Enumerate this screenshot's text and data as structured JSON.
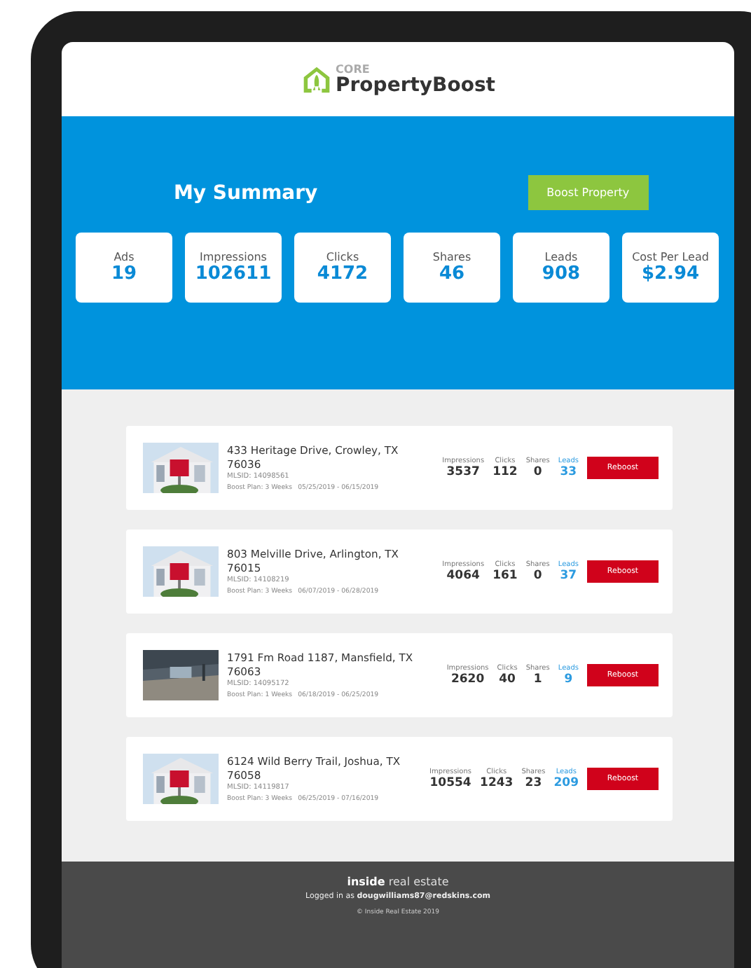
{
  "logo": {
    "small": "CORE",
    "name": "PropertyBoost"
  },
  "summary": {
    "title": "My Summary",
    "button": "Boost Property",
    "stats": [
      {
        "label": "Ads",
        "value": "19"
      },
      {
        "label": "Impressions",
        "value": "102611"
      },
      {
        "label": "Clicks",
        "value": "4172"
      },
      {
        "label": "Shares",
        "value": "46"
      },
      {
        "label": "Leads",
        "value": "908"
      },
      {
        "label": "Cost Per Lead",
        "value": "$2.94"
      }
    ]
  },
  "listings": [
    {
      "address": "433 Heritage Drive, Crowley, TX 76036",
      "mlsid": "MLSID: 14098561",
      "plan": "Boost Plan: 3 Weeks",
      "dates": "05/25/2019 - 06/15/2019",
      "button": "Reboost",
      "stats": [
        {
          "label": "Impressions",
          "value": "3537",
          "kind": "plain"
        },
        {
          "label": "Clicks",
          "value": "112",
          "kind": "plain"
        },
        {
          "label": "Shares",
          "value": "0",
          "kind": "plain"
        },
        {
          "label": "Leads",
          "value": "33",
          "kind": "lead"
        }
      ]
    },
    {
      "address": "803 Melville Drive, Arlington, TX 76015",
      "mlsid": "MLSID: 14108219",
      "plan": "Boost Plan: 3 Weeks",
      "dates": "06/07/2019 - 06/28/2019",
      "button": "Reboost",
      "stats": [
        {
          "label": "Impressions",
          "value": "4064",
          "kind": "plain"
        },
        {
          "label": "Clicks",
          "value": "161",
          "kind": "plain"
        },
        {
          "label": "Shares",
          "value": "0",
          "kind": "plain"
        },
        {
          "label": "Leads",
          "value": "37",
          "kind": "lead"
        }
      ]
    },
    {
      "address": "1791 Fm Road 1187, Mansfield, TX 76063",
      "mlsid": "MLSID: 14095172",
      "plan": "Boost Plan: 1 Weeks",
      "dates": "06/18/2019 - 06/25/2019",
      "button": "Reboost",
      "stats": [
        {
          "label": "Impressions",
          "value": "2620",
          "kind": "plain"
        },
        {
          "label": "Clicks",
          "value": "40",
          "kind": "plain"
        },
        {
          "label": "Shares",
          "value": "1",
          "kind": "plain"
        },
        {
          "label": "Leads",
          "value": "9",
          "kind": "lead"
        }
      ]
    },
    {
      "address": "6124 Wild Berry Trail, Joshua, TX 76058",
      "mlsid": "MLSID: 14119817",
      "plan": "Boost Plan: 3 Weeks",
      "dates": "06/25/2019 - 07/16/2019",
      "button": "Reboost",
      "stats": [
        {
          "label": "Impressions",
          "value": "10554",
          "kind": "plain"
        },
        {
          "label": "Clicks",
          "value": "1243",
          "kind": "plain"
        },
        {
          "label": "Shares",
          "value": "23",
          "kind": "plain"
        },
        {
          "label": "Leads",
          "value": "209",
          "kind": "lead"
        }
      ]
    }
  ],
  "footer": {
    "brand_bold": "inside",
    "brand_light": "real estate",
    "login": "Logged in as **dougwilliams87@redskins.com**",
    "copyright": "© Inside Real Estate 2019"
  }
}
